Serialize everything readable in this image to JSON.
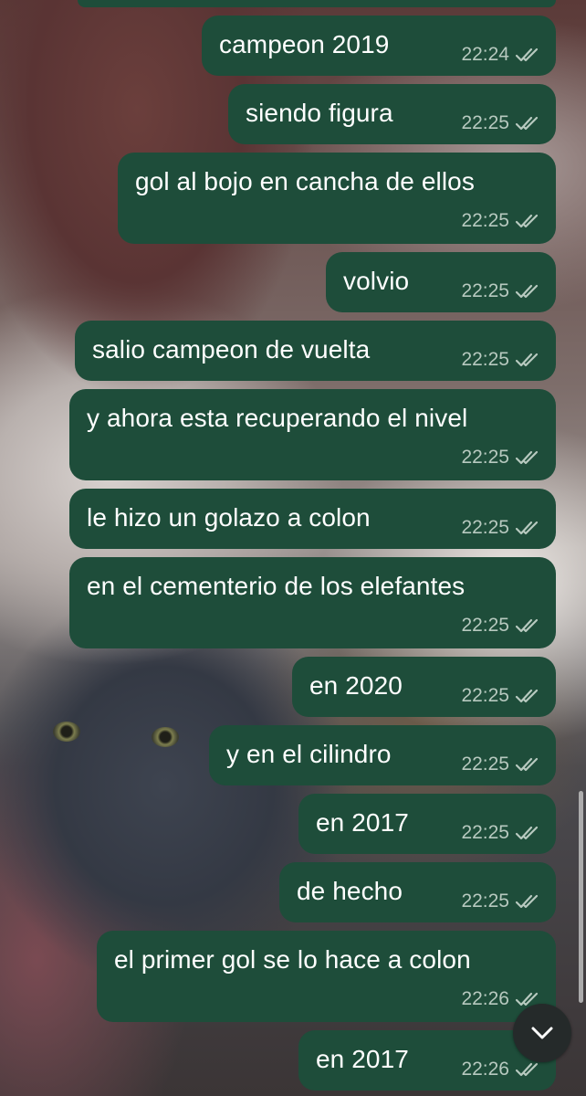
{
  "colors": {
    "bubble": "#1e4d3a",
    "bubble_text": "#ffffff",
    "meta_text": "#b7c9bf"
  },
  "icons": {
    "read_receipt": "double-check-icon",
    "jump": "chevron-down-icon"
  },
  "messages": [
    {
      "text": "campeon 2019",
      "time": "22:24"
    },
    {
      "text": "siendo figura",
      "time": "22:25"
    },
    {
      "text": "gol al bojo en cancha de ellos",
      "time": "22:25"
    },
    {
      "text": "volvio",
      "time": "22:25"
    },
    {
      "text": "salio campeon de vuelta",
      "time": "22:25"
    },
    {
      "text": "y ahora esta recuperando el nivel",
      "time": "22:25"
    },
    {
      "text": "le hizo un golazo a colon",
      "time": "22:25"
    },
    {
      "text": "en el cementerio de los elefantes",
      "time": "22:25"
    },
    {
      "text": "en 2020",
      "time": "22:25"
    },
    {
      "text": "y en el cilindro",
      "time": "22:25"
    },
    {
      "text": "en 2017",
      "time": "22:25"
    },
    {
      "text": "de hecho",
      "time": "22:25"
    },
    {
      "text": "el primer gol se lo hace a colon",
      "time": "22:26"
    },
    {
      "text": "en 2017",
      "time": "22:26"
    }
  ]
}
